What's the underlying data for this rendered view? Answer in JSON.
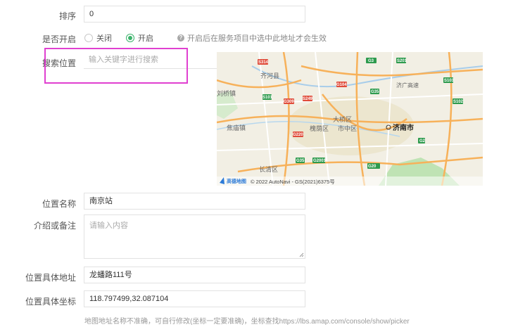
{
  "sort": {
    "label": "排序",
    "value": "0"
  },
  "enable": {
    "label": "是否开启",
    "off_label": "关闭",
    "on_label": "开启",
    "selected": "on",
    "hint": "开启后在服务项目中选中此地址才会生效"
  },
  "search": {
    "label": "搜索位置",
    "placeholder": "输入关键字进行搜索"
  },
  "map": {
    "place_labels": [
      "齐河县",
      "刘桥镇",
      "焦庙镇",
      "槐荫区",
      "市中区",
      "济南市",
      "大桥区",
      "长清区",
      "济广高速"
    ],
    "road_badges": [
      "S314",
      "G3",
      "G35",
      "G220",
      "S249",
      "G309",
      "S201",
      "G2001",
      "G2",
      "G104",
      "S103",
      "G20",
      "S102",
      "G35",
      "S101"
    ],
    "logo_text": "高德地图",
    "copyright": "© 2022 AutoNavi - GS(2021)6375号"
  },
  "location_name": {
    "label": "位置名称",
    "value": "南京站"
  },
  "remark": {
    "label": "介绍或备注",
    "placeholder": "请输入内容"
  },
  "address": {
    "label": "位置具体地址",
    "value": "龙蟠路111号"
  },
  "coords": {
    "label": "位置具体坐标",
    "value": "118.797499,32.087104"
  },
  "footer_hint": "地图地址名称不准确，可自行修改(坐标一定要准确)，坐标查找https://lbs.amap.com/console/show/picker",
  "colors": {
    "accent": "#3bb36b",
    "highlight": "#e040d0",
    "road_major": "#f7b15a",
    "badge_green": "#2e9b4e",
    "badge_red": "#e04b3a"
  }
}
